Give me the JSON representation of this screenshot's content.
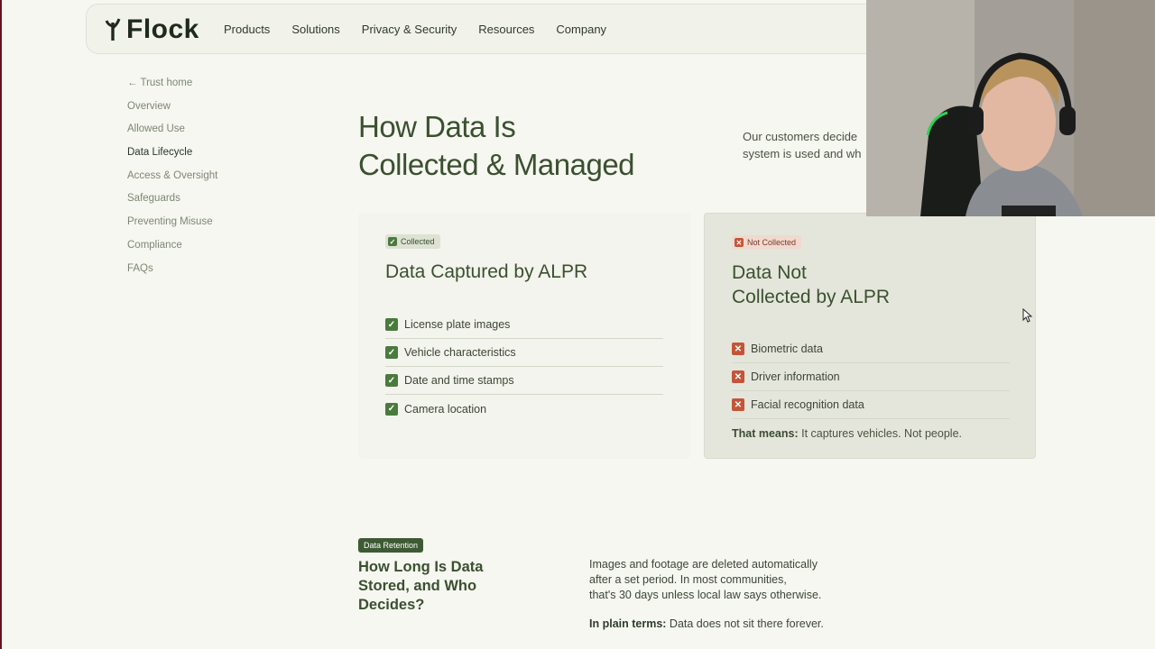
{
  "header": {
    "logo_text": "Flock",
    "nav": [
      "Products",
      "Solutions",
      "Privacy & Security",
      "Resources",
      "Company"
    ]
  },
  "sidebar": {
    "back": "← Trust home",
    "items": [
      "Overview",
      "Allowed Use",
      "Data Lifecycle",
      "Access & Oversight",
      "Safeguards",
      "Preventing Misuse",
      "Compliance",
      "FAQs"
    ],
    "active": "Data Lifecycle"
  },
  "main": {
    "title_line1": "How Data Is",
    "title_line2": "Collected & Managed",
    "intro_line1": "Our customers decide",
    "intro_line2": "system is used and wh"
  },
  "collected": {
    "badge": "Collected",
    "title": "Data Captured by ALPR",
    "items": [
      "License plate images",
      "Vehicle characteristics",
      "Date and time stamps",
      "Camera location"
    ]
  },
  "not_collected": {
    "badge": "Not Collected",
    "title_line1": "Data Not",
    "title_line2": "Collected by ALPR",
    "items": [
      "Biometric data",
      "Driver information",
      "Facial recognition data"
    ],
    "means_label": "That means:",
    "means_text": " It captures vehicles. Not people."
  },
  "retention": {
    "badge": "Data Retention",
    "title": "How Long Is Data Stored, and Who Decides?",
    "text_line1": "Images and footage are deleted automatically",
    "text_line2": "after a set period. In most communities,",
    "text_line3": "that's 30 days unless local law says otherwise.",
    "plain_label": "In plain terms:",
    "plain_text": " Data does not sit there forever."
  },
  "colors": {
    "accent": "#3b5030",
    "check": "#4a7a3e",
    "cross": "#c4553a",
    "background": "#f6f7f1"
  }
}
